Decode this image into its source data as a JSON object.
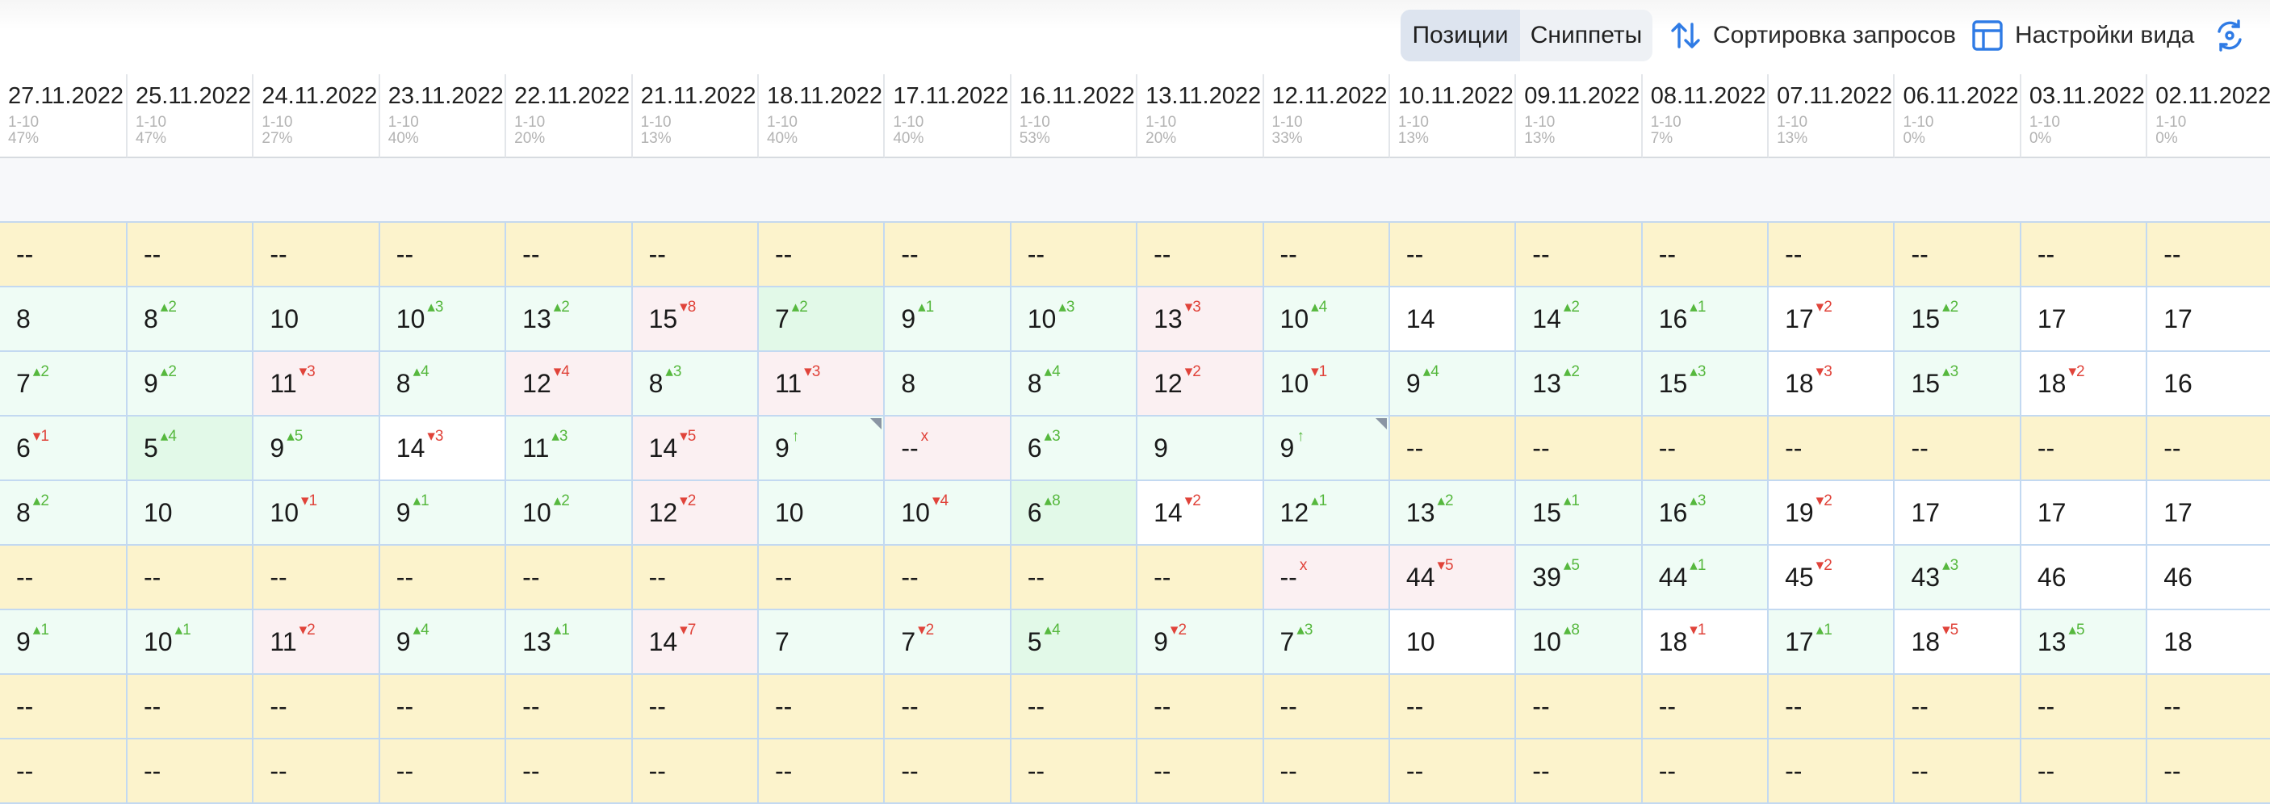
{
  "toolbar": {
    "tab_positions": "Позиции",
    "tab_snippets": "Сниппеты",
    "sort_label": "Сортировка запросов",
    "view_label": "Настройки вида",
    "sort_icon": "sort-arrows-icon",
    "view_icon": "table-layout-icon",
    "extra_icon": "refresh-target-icon"
  },
  "columns": [
    {
      "date": "27.11.2022",
      "range": "1-10",
      "pct": "47%"
    },
    {
      "date": "25.11.2022",
      "range": "1-10",
      "pct": "47%"
    },
    {
      "date": "24.11.2022",
      "range": "1-10",
      "pct": "27%"
    },
    {
      "date": "23.11.2022",
      "range": "1-10",
      "pct": "40%"
    },
    {
      "date": "22.11.2022",
      "range": "1-10",
      "pct": "20%"
    },
    {
      "date": "21.11.2022",
      "range": "1-10",
      "pct": "13%"
    },
    {
      "date": "18.11.2022",
      "range": "1-10",
      "pct": "40%"
    },
    {
      "date": "17.11.2022",
      "range": "1-10",
      "pct": "40%"
    },
    {
      "date": "16.11.2022",
      "range": "1-10",
      "pct": "53%"
    },
    {
      "date": "13.11.2022",
      "range": "1-10",
      "pct": "20%"
    },
    {
      "date": "12.11.2022",
      "range": "1-10",
      "pct": "33%"
    },
    {
      "date": "10.11.2022",
      "range": "1-10",
      "pct": "13%"
    },
    {
      "date": "09.11.2022",
      "range": "1-10",
      "pct": "13%"
    },
    {
      "date": "08.11.2022",
      "range": "1-10",
      "pct": "7%"
    },
    {
      "date": "07.11.2022",
      "range": "1-10",
      "pct": "13%"
    },
    {
      "date": "06.11.2022",
      "range": "1-10",
      "pct": "0%"
    },
    {
      "date": "03.11.2022",
      "range": "1-10",
      "pct": "0%"
    },
    {
      "date": "02.11.2022",
      "range": "1-10",
      "pct": "0%"
    }
  ],
  "rows": [
    [
      [
        "--",
        "",
        "",
        "y"
      ],
      [
        "--",
        "",
        "",
        "y"
      ],
      [
        "--",
        "",
        "",
        "y"
      ],
      [
        "--",
        "",
        "",
        "y"
      ],
      [
        "--",
        "",
        "",
        "y"
      ],
      [
        "--",
        "",
        "",
        "y"
      ],
      [
        "--",
        "",
        "",
        "y"
      ],
      [
        "--",
        "",
        "",
        "y"
      ],
      [
        "--",
        "",
        "",
        "y"
      ],
      [
        "--",
        "",
        "",
        "y"
      ],
      [
        "--",
        "",
        "",
        "y"
      ],
      [
        "--",
        "",
        "",
        "y"
      ],
      [
        "--",
        "",
        "",
        "y"
      ],
      [
        "--",
        "",
        "",
        "y"
      ],
      [
        "--",
        "",
        "",
        "y"
      ],
      [
        "--",
        "",
        "",
        "y"
      ],
      [
        "--",
        "",
        "",
        "y"
      ],
      [
        "--",
        "",
        "",
        "y"
      ]
    ],
    [
      [
        "8",
        "",
        "",
        "g"
      ],
      [
        "8",
        "▴2",
        "up",
        "g"
      ],
      [
        "10",
        "",
        "",
        "g"
      ],
      [
        "10",
        "▴3",
        "up",
        "g"
      ],
      [
        "13",
        "▴2",
        "up",
        "g"
      ],
      [
        "15",
        "▾8",
        "dn",
        "r"
      ],
      [
        "7",
        "▴2",
        "up",
        "gg"
      ],
      [
        "9",
        "▴1",
        "up",
        "g"
      ],
      [
        "10",
        "▴3",
        "up",
        "g"
      ],
      [
        "13",
        "▾3",
        "dn",
        "r"
      ],
      [
        "10",
        "▴4",
        "up",
        "g"
      ],
      [
        "14",
        "",
        "",
        "w"
      ],
      [
        "14",
        "▴2",
        "up",
        "g"
      ],
      [
        "16",
        "▴1",
        "up",
        "g"
      ],
      [
        "17",
        "▾2",
        "dn",
        "w"
      ],
      [
        "15",
        "▴2",
        "up",
        "g"
      ],
      [
        "17",
        "",
        "",
        "w"
      ],
      [
        "17",
        "",
        "",
        "w"
      ]
    ],
    [
      [
        "7",
        "▴2",
        "up",
        "g"
      ],
      [
        "9",
        "▴2",
        "up",
        "g"
      ],
      [
        "11",
        "▾3",
        "dn",
        "r"
      ],
      [
        "8",
        "▴4",
        "up",
        "g"
      ],
      [
        "12",
        "▾4",
        "dn",
        "r"
      ],
      [
        "8",
        "▴3",
        "up",
        "g"
      ],
      [
        "11",
        "▾3",
        "dn",
        "r"
      ],
      [
        "8",
        "",
        "",
        "g"
      ],
      [
        "8",
        "▴4",
        "up",
        "g"
      ],
      [
        "12",
        "▾2",
        "dn",
        "r"
      ],
      [
        "10",
        "▾1",
        "dn",
        "g"
      ],
      [
        "9",
        "▴4",
        "up",
        "g"
      ],
      [
        "13",
        "▴2",
        "up",
        "g"
      ],
      [
        "15",
        "▴3",
        "up",
        "g"
      ],
      [
        "18",
        "▾3",
        "dn",
        "w"
      ],
      [
        "15",
        "▴3",
        "up",
        "g"
      ],
      [
        "18",
        "▾2",
        "dn",
        "w"
      ],
      [
        "16",
        "",
        "",
        "w"
      ]
    ],
    [
      [
        "6",
        "▾1",
        "dn",
        "g"
      ],
      [
        "5",
        "▴4",
        "up",
        "gg"
      ],
      [
        "9",
        "▴5",
        "up",
        "g"
      ],
      [
        "14",
        "▾3",
        "dn",
        "w"
      ],
      [
        "11",
        "▴3",
        "up",
        "g"
      ],
      [
        "14",
        "▾5",
        "dn",
        "r"
      ],
      [
        "9",
        "↑",
        "up",
        "g",
        "corner"
      ],
      [
        "--",
        "x",
        "x",
        "r"
      ],
      [
        "6",
        "▴3",
        "up",
        "g"
      ],
      [
        "9",
        "",
        "",
        "g"
      ],
      [
        "9",
        "↑",
        "up",
        "g",
        "corner"
      ],
      [
        "--",
        "",
        "",
        "y"
      ],
      [
        "--",
        "",
        "",
        "y"
      ],
      [
        "--",
        "",
        "",
        "y"
      ],
      [
        "--",
        "",
        "",
        "y"
      ],
      [
        "--",
        "",
        "",
        "y"
      ],
      [
        "--",
        "",
        "",
        "y"
      ],
      [
        "--",
        "",
        "",
        "y"
      ]
    ],
    [
      [
        "8",
        "▴2",
        "up",
        "g"
      ],
      [
        "10",
        "",
        "",
        "g"
      ],
      [
        "10",
        "▾1",
        "dn",
        "g"
      ],
      [
        "9",
        "▴1",
        "up",
        "g"
      ],
      [
        "10",
        "▴2",
        "up",
        "g"
      ],
      [
        "12",
        "▾2",
        "dn",
        "r"
      ],
      [
        "10",
        "",
        "",
        "g"
      ],
      [
        "10",
        "▾4",
        "dn",
        "g"
      ],
      [
        "6",
        "▴8",
        "up",
        "gg"
      ],
      [
        "14",
        "▾2",
        "dn",
        "w"
      ],
      [
        "12",
        "▴1",
        "up",
        "g"
      ],
      [
        "13",
        "▴2",
        "up",
        "g"
      ],
      [
        "15",
        "▴1",
        "up",
        "g"
      ],
      [
        "16",
        "▴3",
        "up",
        "g"
      ],
      [
        "19",
        "▾2",
        "dn",
        "w"
      ],
      [
        "17",
        "",
        "",
        "w"
      ],
      [
        "17",
        "",
        "",
        "w"
      ],
      [
        "17",
        "",
        "",
        "w"
      ]
    ],
    [
      [
        "--",
        "",
        "",
        "y"
      ],
      [
        "--",
        "",
        "",
        "y"
      ],
      [
        "--",
        "",
        "",
        "y"
      ],
      [
        "--",
        "",
        "",
        "y"
      ],
      [
        "--",
        "",
        "",
        "y"
      ],
      [
        "--",
        "",
        "",
        "y"
      ],
      [
        "--",
        "",
        "",
        "y"
      ],
      [
        "--",
        "",
        "",
        "y"
      ],
      [
        "--",
        "",
        "",
        "y"
      ],
      [
        "--",
        "",
        "",
        "y"
      ],
      [
        "--",
        "x",
        "x",
        "r"
      ],
      [
        "44",
        "▾5",
        "dn",
        "r"
      ],
      [
        "39",
        "▴5",
        "up",
        "g"
      ],
      [
        "44",
        "▴1",
        "up",
        "g"
      ],
      [
        "45",
        "▾2",
        "dn",
        "w"
      ],
      [
        "43",
        "▴3",
        "up",
        "g"
      ],
      [
        "46",
        "",
        "",
        "w"
      ],
      [
        "46",
        "",
        "",
        "w"
      ]
    ],
    [
      [
        "9",
        "▴1",
        "up",
        "g"
      ],
      [
        "10",
        "▴1",
        "up",
        "g"
      ],
      [
        "11",
        "▾2",
        "dn",
        "r"
      ],
      [
        "9",
        "▴4",
        "up",
        "g"
      ],
      [
        "13",
        "▴1",
        "up",
        "g"
      ],
      [
        "14",
        "▾7",
        "dn",
        "r"
      ],
      [
        "7",
        "",
        "",
        "g"
      ],
      [
        "7",
        "▾2",
        "dn",
        "g"
      ],
      [
        "5",
        "▴4",
        "up",
        "gg"
      ],
      [
        "9",
        "▾2",
        "dn",
        "g"
      ],
      [
        "7",
        "▴3",
        "up",
        "g"
      ],
      [
        "10",
        "",
        "",
        "w"
      ],
      [
        "10",
        "▴8",
        "up",
        "g"
      ],
      [
        "18",
        "▾1",
        "dn",
        "w"
      ],
      [
        "17",
        "▴1",
        "up",
        "g"
      ],
      [
        "18",
        "▾5",
        "dn",
        "w"
      ],
      [
        "13",
        "▴5",
        "up",
        "g"
      ],
      [
        "18",
        "",
        "",
        "w"
      ]
    ],
    [
      [
        "--",
        "",
        "",
        "y"
      ],
      [
        "--",
        "",
        "",
        "y"
      ],
      [
        "--",
        "",
        "",
        "y"
      ],
      [
        "--",
        "",
        "",
        "y"
      ],
      [
        "--",
        "",
        "",
        "y"
      ],
      [
        "--",
        "",
        "",
        "y"
      ],
      [
        "--",
        "",
        "",
        "y"
      ],
      [
        "--",
        "",
        "",
        "y"
      ],
      [
        "--",
        "",
        "",
        "y"
      ],
      [
        "--",
        "",
        "",
        "y"
      ],
      [
        "--",
        "",
        "",
        "y"
      ],
      [
        "--",
        "",
        "",
        "y"
      ],
      [
        "--",
        "",
        "",
        "y"
      ],
      [
        "--",
        "",
        "",
        "y"
      ],
      [
        "--",
        "",
        "",
        "y"
      ],
      [
        "--",
        "",
        "",
        "y"
      ],
      [
        "--",
        "",
        "",
        "y"
      ],
      [
        "--",
        "",
        "",
        "y"
      ]
    ],
    [
      [
        "--",
        "",
        "",
        "y"
      ],
      [
        "--",
        "",
        "",
        "y"
      ],
      [
        "--",
        "",
        "",
        "y"
      ],
      [
        "--",
        "",
        "",
        "y"
      ],
      [
        "--",
        "",
        "",
        "y"
      ],
      [
        "--",
        "",
        "",
        "y"
      ],
      [
        "--",
        "",
        "",
        "y"
      ],
      [
        "--",
        "",
        "",
        "y"
      ],
      [
        "--",
        "",
        "",
        "y"
      ],
      [
        "--",
        "",
        "",
        "y"
      ],
      [
        "--",
        "",
        "",
        "y"
      ],
      [
        "--",
        "",
        "",
        "y"
      ],
      [
        "--",
        "",
        "",
        "y"
      ],
      [
        "--",
        "",
        "",
        "y"
      ],
      [
        "--",
        "",
        "",
        "y"
      ],
      [
        "--",
        "",
        "",
        "y"
      ],
      [
        "--",
        "",
        "",
        "y"
      ],
      [
        "--",
        "",
        "",
        "y"
      ]
    ]
  ]
}
